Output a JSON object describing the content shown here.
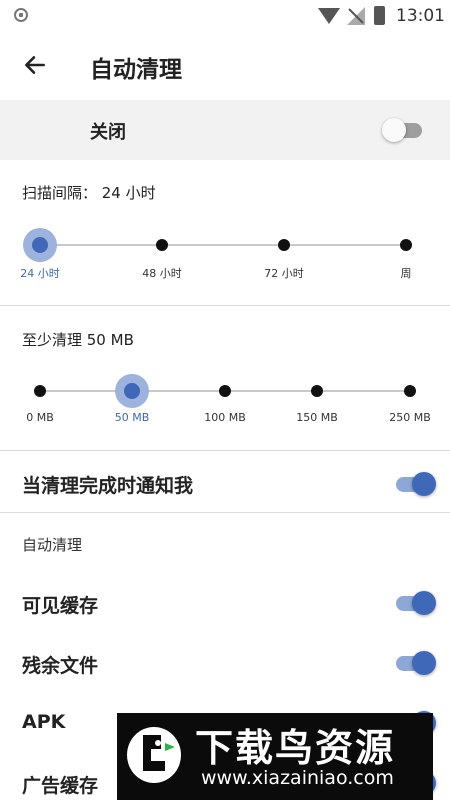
{
  "status_bar": {
    "time": "13:01",
    "icons": [
      "app-shield-icon",
      "wifi-icon",
      "no-sim-icon",
      "battery-charging-icon"
    ]
  },
  "app_bar": {
    "back_icon": "arrow-left-icon",
    "title": "自动清理"
  },
  "master_switch": {
    "label": "关闭",
    "state": "off"
  },
  "scan_interval": {
    "label": "扫描间隔： 24 小时",
    "options": [
      "24 小时",
      "48 小时",
      "72 小时",
      "周"
    ],
    "selected_index": 0
  },
  "min_clean": {
    "label": "至少清理 50 MB",
    "options": [
      "0 MB",
      "50 MB",
      "100 MB",
      "150 MB",
      "250 MB"
    ],
    "selected_index": 1
  },
  "notify": {
    "label": "当清理完成时通知我",
    "state": "on"
  },
  "auto_clean": {
    "header": "自动清理",
    "items": [
      {
        "label": "可见缓存",
        "state": "on"
      },
      {
        "label": "残余文件",
        "state": "on"
      },
      {
        "label": "APK",
        "state": "on"
      },
      {
        "label": "广告缓存",
        "state": "on"
      }
    ]
  },
  "watermark": {
    "big": "下载鸟资源",
    "small": "www.xiazainiao.com"
  },
  "colors": {
    "accent": "#3f68b8",
    "accent_light": "#9db3de",
    "master_bg": "#f2f2f2"
  }
}
